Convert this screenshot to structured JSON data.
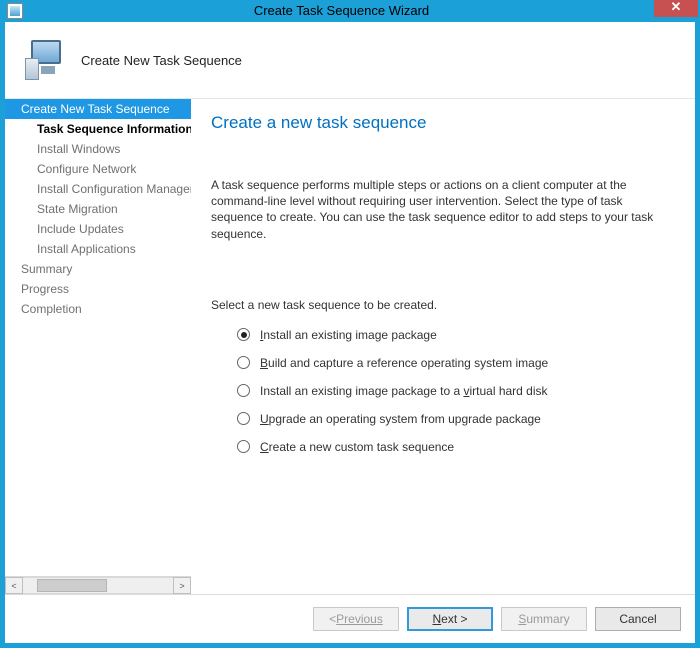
{
  "window": {
    "title": "Create Task Sequence Wizard"
  },
  "header": {
    "title": "Create New Task Sequence"
  },
  "sidebar": {
    "items": [
      {
        "label": "Create New Task Sequence",
        "level": 1,
        "active": true
      },
      {
        "label": "Task Sequence Information",
        "level": 2,
        "bold": true
      },
      {
        "label": "Install Windows",
        "level": 2
      },
      {
        "label": "Configure Network",
        "level": 2
      },
      {
        "label": "Install Configuration Manager",
        "level": 2
      },
      {
        "label": "State Migration",
        "level": 2
      },
      {
        "label": "Include Updates",
        "level": 2
      },
      {
        "label": "Install Applications",
        "level": 2
      },
      {
        "label": "Summary",
        "level": 1
      },
      {
        "label": "Progress",
        "level": 1
      },
      {
        "label": "Completion",
        "level": 1
      }
    ]
  },
  "main": {
    "title": "Create a new task sequence",
    "description": "A task sequence performs multiple steps or actions on a client computer at the command-line level without requiring user intervention. Select the type of task sequence to create. You can use the task sequence editor to add steps to your task sequence.",
    "prompt": "Select a new task sequence to be created.",
    "options": [
      {
        "label": "Install an existing image package",
        "accel": "I",
        "checked": true
      },
      {
        "label": "Build and capture a reference operating system image",
        "accel": "B",
        "checked": false
      },
      {
        "label": "Install an existing image package to a virtual hard disk",
        "accel": "v",
        "checked": false
      },
      {
        "label": "Upgrade an operating system from upgrade package",
        "accel": "U",
        "checked": false
      },
      {
        "label": "Create a new custom task sequence",
        "accel": "C",
        "checked": false
      }
    ]
  },
  "footer": {
    "previous": "Previous",
    "next": "Next >",
    "summary": "Summary",
    "cancel": "Cancel"
  }
}
